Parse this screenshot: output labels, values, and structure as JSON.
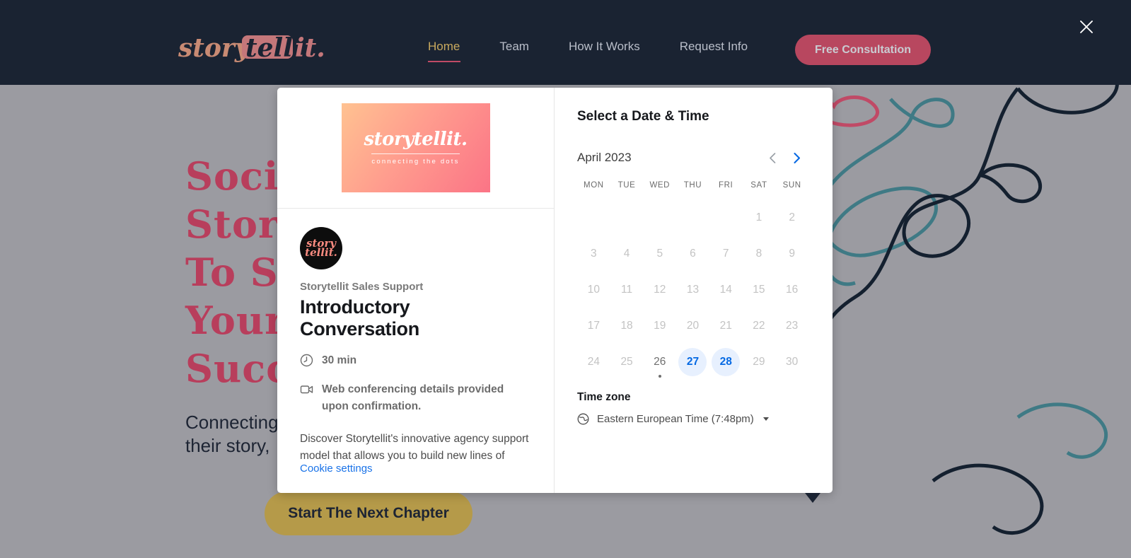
{
  "header": {
    "logo_text": "storytellit.",
    "nav_items": [
      {
        "label": "Home",
        "active": true
      },
      {
        "label": "Team",
        "active": false
      },
      {
        "label": "How It Works",
        "active": false
      },
      {
        "label": "Request Info",
        "active": false
      }
    ],
    "cta_label": "Free Consultation",
    "close_icon": "close-icon",
    "bg_color": "#1a2332",
    "accent_color": "#b8475f",
    "active_nav_color": "#c8a95e"
  },
  "page": {
    "hero_title": "Soci\nStor\nTo S\nYour\nSucc",
    "hero_subtitle": "Connecting\ntheir story,",
    "cta_label": "Start The Next Chapter",
    "overlay_color": "#9b9ba1",
    "hero_title_color": "#b83e5c",
    "cta_bg_color": "#b59a49"
  },
  "modal": {
    "banner": {
      "logo_text": "storytellit.",
      "tagline": "connecting the dots",
      "gradient_from": "#ffc291",
      "gradient_to": "#fb7486"
    },
    "avatar": {
      "line1": "story",
      "line2": "tellit."
    },
    "host": "Storytellit Sales Support",
    "event_title": "Introductory Conversation",
    "duration": "30 min",
    "duration_icon": "clock-icon",
    "location": "Web conferencing details provided upon confirmation.",
    "location_icon": "video-camera-icon",
    "description": "Discover Storytellit's innovative agency support model that allows you to build new lines of",
    "cookie_link": "Cookie settings",
    "cookie_link_color": "#1a73e8"
  },
  "calendar": {
    "heading": "Select a Date & Time",
    "month_label": "April 2023",
    "prev_icon": "chevron-left-icon",
    "next_icon": "chevron-right-icon",
    "prev_enabled": false,
    "next_enabled": true,
    "weekdays": [
      "MON",
      "TUE",
      "WED",
      "THU",
      "FRI",
      "SAT",
      "SUN"
    ],
    "weeks": [
      [
        {
          "day": "",
          "state": "empty"
        },
        {
          "day": "",
          "state": "empty"
        },
        {
          "day": "",
          "state": "empty"
        },
        {
          "day": "",
          "state": "empty"
        },
        {
          "day": "",
          "state": "empty"
        },
        {
          "day": "1",
          "state": "past"
        },
        {
          "day": "2",
          "state": "past"
        }
      ],
      [
        {
          "day": "3",
          "state": "past"
        },
        {
          "day": "4",
          "state": "past"
        },
        {
          "day": "5",
          "state": "past"
        },
        {
          "day": "6",
          "state": "past"
        },
        {
          "day": "7",
          "state": "past"
        },
        {
          "day": "8",
          "state": "past"
        },
        {
          "day": "9",
          "state": "past"
        }
      ],
      [
        {
          "day": "10",
          "state": "past"
        },
        {
          "day": "11",
          "state": "past"
        },
        {
          "day": "12",
          "state": "past"
        },
        {
          "day": "13",
          "state": "past"
        },
        {
          "day": "14",
          "state": "past"
        },
        {
          "day": "15",
          "state": "past"
        },
        {
          "day": "16",
          "state": "past"
        }
      ],
      [
        {
          "day": "17",
          "state": "past"
        },
        {
          "day": "18",
          "state": "past"
        },
        {
          "day": "19",
          "state": "past"
        },
        {
          "day": "20",
          "state": "past"
        },
        {
          "day": "21",
          "state": "past"
        },
        {
          "day": "22",
          "state": "past"
        },
        {
          "day": "23",
          "state": "past"
        }
      ],
      [
        {
          "day": "24",
          "state": "past"
        },
        {
          "day": "25",
          "state": "past"
        },
        {
          "day": "26",
          "state": "today"
        },
        {
          "day": "27",
          "state": "available"
        },
        {
          "day": "28",
          "state": "available"
        },
        {
          "day": "29",
          "state": "past"
        },
        {
          "day": "30",
          "state": "past"
        }
      ]
    ],
    "available_bg": "#e7f0fe",
    "available_color": "#0569e3"
  },
  "timezone": {
    "heading": "Time zone",
    "value": "Eastern European Time (7:48pm)",
    "icon": "globe-icon"
  }
}
